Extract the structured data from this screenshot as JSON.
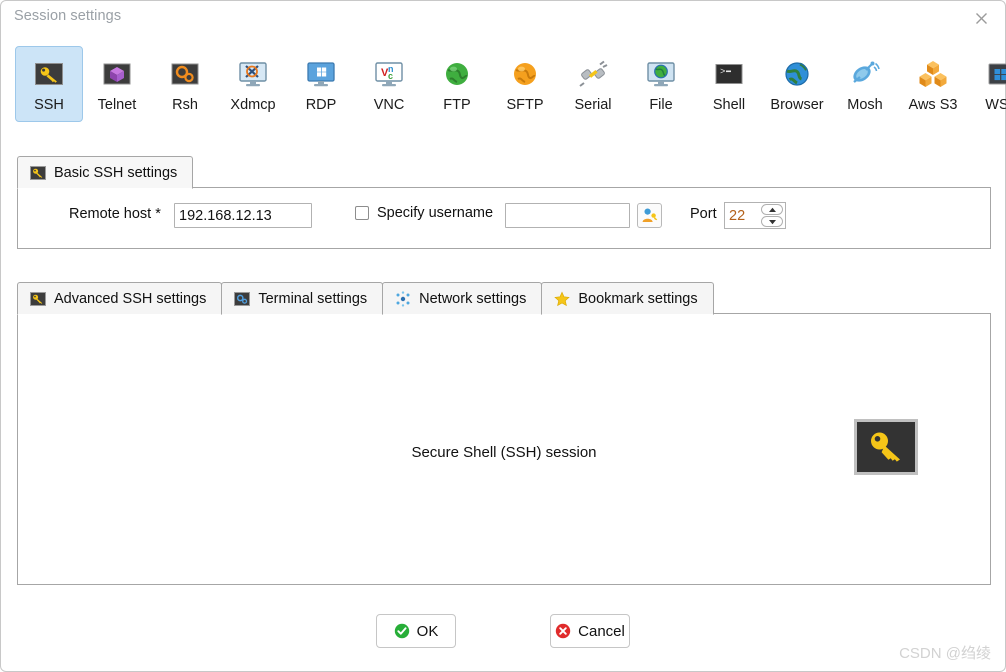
{
  "window": {
    "title": "Session settings",
    "close_icon": "close-icon"
  },
  "protocols": [
    {
      "label": "SSH",
      "icon": "ssh-key-icon",
      "selected": true
    },
    {
      "label": "Telnet",
      "icon": "telnet-cube-icon",
      "selected": false
    },
    {
      "label": "Rsh",
      "icon": "rsh-gears-icon",
      "selected": false
    },
    {
      "label": "Xdmcp",
      "icon": "xdmcp-monitor-icon",
      "selected": false
    },
    {
      "label": "RDP",
      "icon": "rdp-monitor-icon",
      "selected": false
    },
    {
      "label": "VNC",
      "icon": "vnc-monitor-icon",
      "selected": false
    },
    {
      "label": "FTP",
      "icon": "ftp-globe-icon",
      "selected": false
    },
    {
      "label": "SFTP",
      "icon": "sftp-globe-icon",
      "selected": false
    },
    {
      "label": "Serial",
      "icon": "serial-plug-icon",
      "selected": false
    },
    {
      "label": "File",
      "icon": "file-monitor-icon",
      "selected": false
    },
    {
      "label": "Shell",
      "icon": "shell-terminal-icon",
      "selected": false
    },
    {
      "label": "Browser",
      "icon": "browser-globe-icon",
      "selected": false
    },
    {
      "label": "Mosh",
      "icon": "mosh-satellite-icon",
      "selected": false
    },
    {
      "label": "Aws S3",
      "icon": "aws-s3-cubes-icon",
      "selected": false
    },
    {
      "label": "WSL",
      "icon": "wsl-windows-icon",
      "selected": false
    }
  ],
  "basic_tab": {
    "label": "Basic SSH settings",
    "icon": "key-icon"
  },
  "basic_form": {
    "remote_host_label": "Remote host *",
    "remote_host_value": "192.168.12.13",
    "remote_host_placeholder": "",
    "specify_username_label": "Specify username",
    "specify_username_checked": false,
    "username_value": "",
    "username_placeholder": "",
    "username_button_icon": "user-key-icon",
    "port_label": "Port",
    "port_value": "22"
  },
  "settings_tabs": [
    {
      "label": "Advanced SSH settings",
      "icon": "key-icon",
      "active": true
    },
    {
      "label": "Terminal settings",
      "icon": "gears-icon",
      "active": false
    },
    {
      "label": "Network settings",
      "icon": "network-icon",
      "active": false
    },
    {
      "label": "Bookmark settings",
      "icon": "star-icon",
      "active": false
    }
  ],
  "content": {
    "session_description": "Secure Shell (SSH) session",
    "session_icon": "large-key-icon"
  },
  "footer": {
    "ok_label": "OK",
    "ok_icon": "green-check-icon",
    "cancel_label": "Cancel",
    "cancel_icon": "red-x-icon"
  },
  "watermark": "CSDN @绉绫",
  "colors": {
    "selected_tile_bg": "#cce4f7",
    "selected_tile_border": "#9dc8ea",
    "accent_key": "#f5c518",
    "ok_green": "#27ae38",
    "cancel_red": "#e02b2b",
    "port_text": "#b3601a",
    "title_grey": "#9aa0a6"
  }
}
